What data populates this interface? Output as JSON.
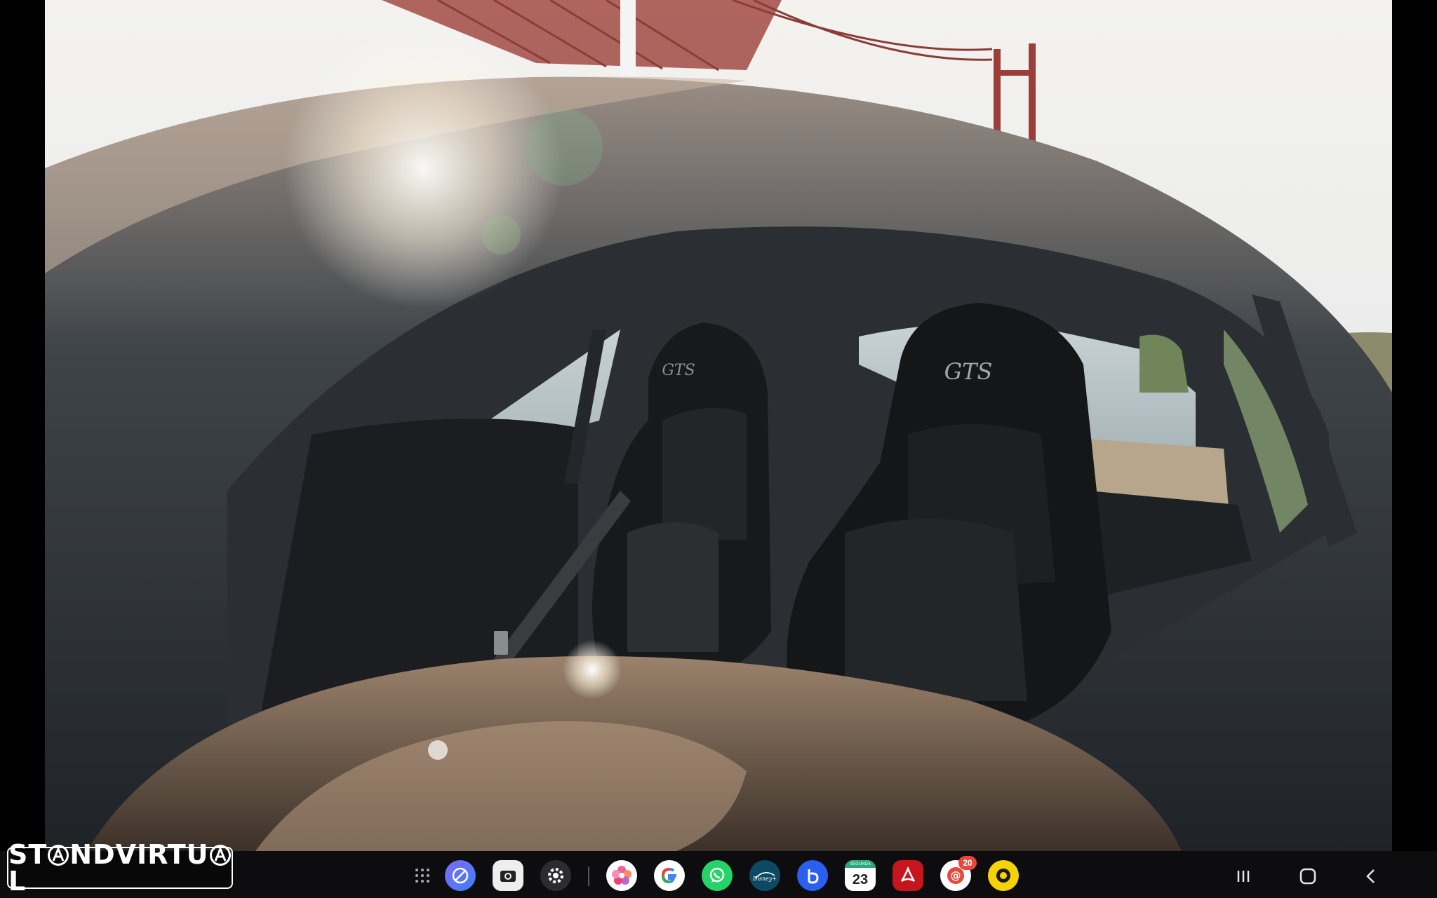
{
  "background_photo": {
    "seat_embroidery_left": "GTS",
    "seat_embroidery_right": "GTS"
  },
  "watermark": {
    "logo_text": "STANDVIRTUAL"
  },
  "taskbar": {
    "apps": [
      {
        "name": "app-drawer",
        "icon": "grid-dots-icon"
      },
      {
        "name": "internet-browser",
        "icon": "browser-icon",
        "color": "#6a5cf5"
      },
      {
        "name": "camera",
        "icon": "camera-icon",
        "color": "#f2f2f2"
      },
      {
        "name": "settings",
        "icon": "gear-icon",
        "color": "#3a3a3a"
      },
      {
        "name": "gallery",
        "icon": "flower-icon",
        "color": "#e2457a"
      },
      {
        "name": "google",
        "icon": "google-icon",
        "color": "#ffffff"
      },
      {
        "name": "whatsapp",
        "icon": "whatsapp-icon",
        "color": "#25d366"
      },
      {
        "name": "disney-plus",
        "icon": "disney-plus-icon",
        "color": "#0c4a63"
      },
      {
        "name": "bixby",
        "icon": "bixby-icon",
        "color": "#2b5ff0"
      },
      {
        "name": "calendar",
        "icon": "calendar-icon",
        "color": "#ffffff",
        "day": "23",
        "weekday": "SEGUNDA"
      },
      {
        "name": "acrobat",
        "icon": "acrobat-icon",
        "color": "#c4161c"
      },
      {
        "name": "email",
        "icon": "email-icon",
        "color": "#e8483b",
        "badge": "20"
      },
      {
        "name": "screen-recorder",
        "icon": "record-icon",
        "color": "#f5d20a"
      }
    ],
    "nav": [
      {
        "name": "recents",
        "icon": "recents-icon"
      },
      {
        "name": "home",
        "icon": "home-icon"
      },
      {
        "name": "back",
        "icon": "back-icon"
      }
    ]
  }
}
